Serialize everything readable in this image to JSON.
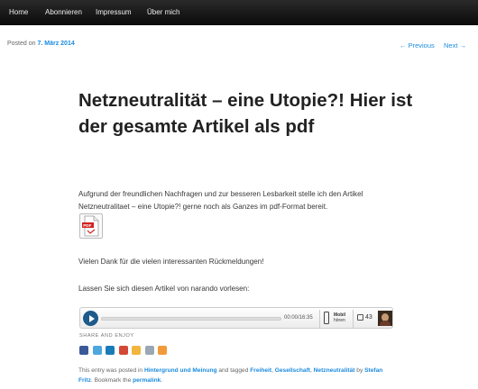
{
  "nav": {
    "items": [
      {
        "label": "Home"
      },
      {
        "label": "Abonnieren"
      },
      {
        "label": "Impressum"
      },
      {
        "label": "Über mich"
      }
    ]
  },
  "meta": {
    "posted_prefix": "Posted on",
    "posted_date": "7. März 2014"
  },
  "pager": {
    "previous": "← Previous",
    "next": "Next →"
  },
  "post": {
    "title": "Netzneutralität – eine Utopie?! Hier ist der gesamte Artikel als pdf",
    "paragraph1": "Aufgrund der freundlichen Nachfragen und zur besseren Lesbarkeit stelle ich den Artikel Netzneutralitaet – eine Utopie?! gerne noch als Ganzes im pdf-Format bereit.",
    "paragraph2": "Vielen Dank für die vielen interessanten Rückmeldungen!",
    "paragraph3": "Lassen Sie sich diesen Artikel von narando vorlesen:"
  },
  "player": {
    "time": "00:00/16:35",
    "mobi_line1": "Mobil",
    "mobi_line2": "hören",
    "count": "43",
    "progress": 0
  },
  "share": {
    "label": "SHARE AND ENJOY",
    "icons": [
      {
        "name": "facebook-icon",
        "color": "#3b5998"
      },
      {
        "name": "twitter-icon",
        "color": "#4da7de"
      },
      {
        "name": "linkedin-icon",
        "color": "#1a7bb9"
      },
      {
        "name": "googleplus-icon",
        "color": "#d34836"
      },
      {
        "name": "favorite-star-icon",
        "color": "#f2b53d"
      },
      {
        "name": "email-icon",
        "color": "#9aa7b5"
      },
      {
        "name": "rss-icon",
        "color": "#f29a39"
      }
    ]
  },
  "footer": {
    "t1": "This entry was posted in",
    "cat1": "Hintergrund und Meinung",
    "t2": "and tagged",
    "tag1": "Freiheit",
    "comma1": ",",
    "tag2": "Gesellschaft",
    "comma2": ",",
    "tag3": "Netzneutralität",
    "t3": "by",
    "author": "Stefan Fritz",
    "t4": ". Bookmark the",
    "permalink": "permalink",
    "end": "."
  }
}
